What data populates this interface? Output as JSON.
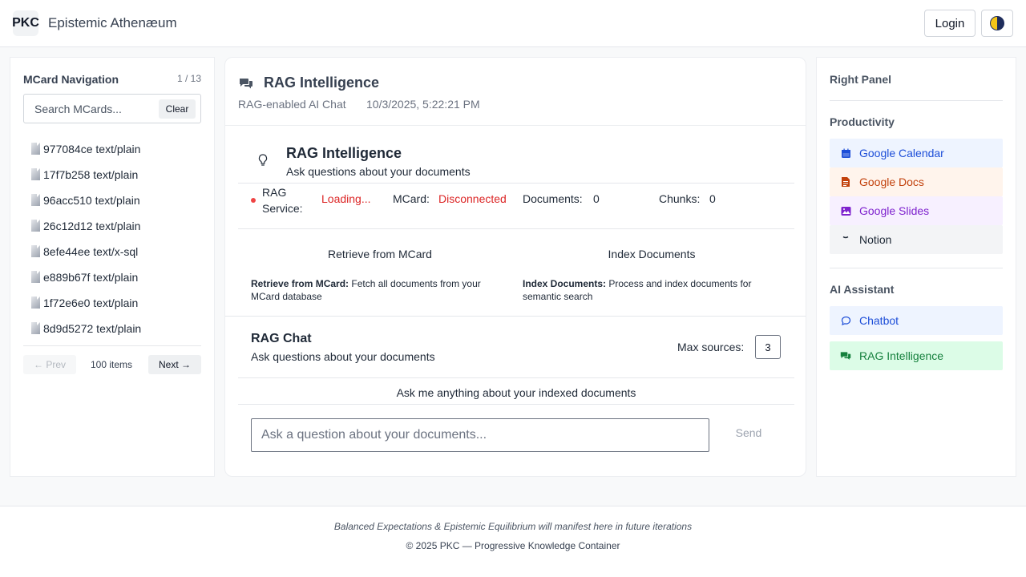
{
  "header": {
    "logo": "PKC",
    "title": "Epistemic Athenæum",
    "login_label": "Login",
    "theme_icon": "half-moon-icon"
  },
  "left": {
    "title": "MCard Navigation",
    "page_count": "1 / 13",
    "search_placeholder": "Search MCards...",
    "clear_label": "Clear",
    "items": [
      {
        "label": "977084ce text/plain"
      },
      {
        "label": "17f7b258 text/plain"
      },
      {
        "label": "96acc510 text/plain"
      },
      {
        "label": "26c12d12 text/plain"
      },
      {
        "label": "8efe44ee text/x-sql"
      },
      {
        "label": "e889b67f text/plain"
      },
      {
        "label": "1f72e6e0 text/plain"
      },
      {
        "label": "8d9d5272 text/plain"
      }
    ],
    "prev_label": "← Prev",
    "items_count": "100 items",
    "next_label": "Next →"
  },
  "center": {
    "title": "RAG Intelligence",
    "subtitle": "RAG-enabled AI Chat",
    "date": "10/3/2025, 5:22:21 PM",
    "rag": {
      "title": "RAG Intelligence",
      "subtitle": "Ask questions about your documents"
    },
    "status": {
      "service_label": "RAG Service:",
      "service_value": "Loading...",
      "mcard_label": "MCard:",
      "mcard_value": "Disconnected",
      "documents_label": "Documents:",
      "documents_value": "0",
      "chunks_label": "Chunks:",
      "chunks_value": "0",
      "status_color": "#ef4444"
    },
    "actions": {
      "retrieve_label": "Retrieve from MCard",
      "index_label": "Index Documents",
      "retrieve_desc_bold": "Retrieve from MCard:",
      "retrieve_desc": "Fetch all documents from your MCard database",
      "index_desc_bold": "Index Documents:",
      "index_desc": "Process and index documents for semantic search"
    },
    "chat": {
      "title": "RAG Chat",
      "subtitle": "Ask questions about your documents",
      "max_sources_label": "Max sources:",
      "max_sources_value": "3",
      "hint": "Ask me anything about your indexed documents",
      "input_placeholder": "Ask a question about your documents...",
      "send_label": "Send"
    }
  },
  "right": {
    "title": "Right Panel",
    "productivity": {
      "title": "Productivity",
      "items": [
        {
          "label": "Google Calendar",
          "icon": "calendar-icon",
          "color": "#1d4ed8",
          "bg": "#eef4ff"
        },
        {
          "label": "Google Docs",
          "icon": "document-icon",
          "color": "#c2410c",
          "bg": "#fff4ec"
        },
        {
          "label": "Google Slides",
          "icon": "image-icon",
          "color": "#7e22ce",
          "bg": "#f7f0ff"
        },
        {
          "label": "Notion",
          "icon": "notion-icon",
          "color": "#1f2937",
          "bg": "#f3f4f6"
        }
      ]
    },
    "ai": {
      "title": "AI Assistant",
      "items": [
        {
          "label": "Chatbot",
          "icon": "chat-bubble-icon",
          "color": "#1d4ed8",
          "bg": "#eef4ff"
        },
        {
          "label": "RAG Intelligence",
          "icon": "chat-bubbles-icon",
          "color": "#15803d",
          "bg": "#dcfce7"
        }
      ]
    }
  },
  "footer": {
    "quote": "Balanced Expectations & Epistemic Equilibrium will manifest here in future iterations",
    "copyright": "© 2025 PKC — Progressive Knowledge Container"
  }
}
